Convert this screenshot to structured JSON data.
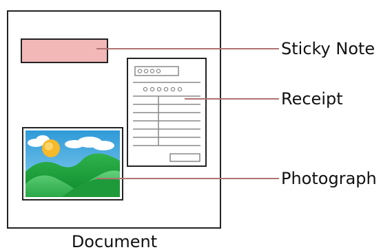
{
  "document": {
    "caption": "Document"
  },
  "callouts": {
    "sticky_note": "Sticky Note",
    "receipt": "Receipt",
    "photograph": "Photograph"
  },
  "colors": {
    "outline": "#222222",
    "sticky_note_fill": "#f2b7b7",
    "leader_line": "#b07272",
    "receipt_lines": "#888888",
    "sky": "#4db0e0",
    "cloud": "#ffffff",
    "sun": "#f6b92a",
    "hill_dark": "#1f9a3a",
    "hill_light": "#3fc25a"
  },
  "icons": {
    "photo": "landscape-photo-icon",
    "receipt": "receipt-icon"
  }
}
